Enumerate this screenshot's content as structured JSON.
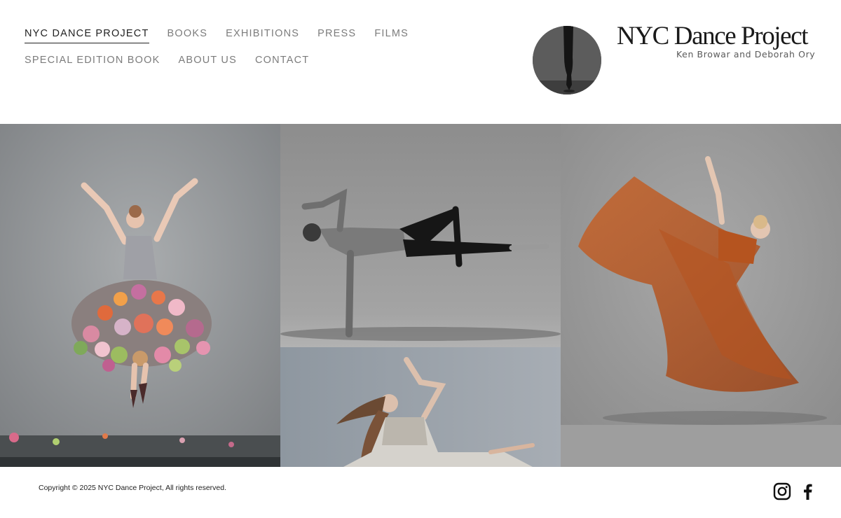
{
  "nav": {
    "row1": [
      {
        "label": "NYC DANCE PROJECT",
        "active": true
      },
      {
        "label": "BOOKS"
      },
      {
        "label": "EXHIBITIONS"
      },
      {
        "label": "PRESS"
      },
      {
        "label": "FILMS"
      }
    ],
    "row2": [
      {
        "label": "SPECIAL EDITION BOOK"
      },
      {
        "label": "ABOUT US"
      },
      {
        "label": "CONTACT"
      }
    ]
  },
  "logo": {
    "title": "NYC Dance Project",
    "subtitle": "Ken Browar and Deborah Ory"
  },
  "footer": {
    "copyright": "Copyright © 2025 NYC Dance Project, All rights reserved.",
    "social": [
      "instagram-icon",
      "facebook-icon"
    ]
  },
  "colors": {
    "nav_text": "#7c7c7c",
    "nav_active": "#222222",
    "photo_backdrop": "#9a9da0",
    "dress_orange": "#b5541f"
  }
}
